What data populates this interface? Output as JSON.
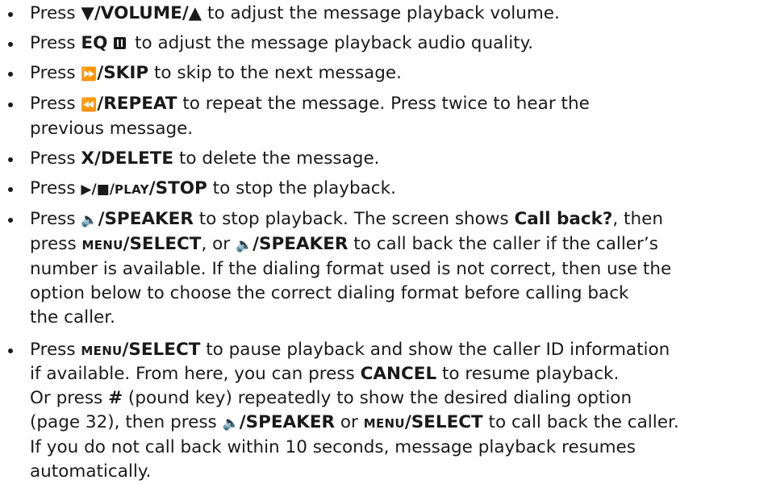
{
  "items": [
    {
      "pre": "Press ",
      "key": "▼/VOLUME/▲",
      "post": " to adjust the message playback volume."
    },
    {
      "pre": "Press ",
      "key": "EQ",
      "icon": "eq-icon",
      "post": " to adjust the message playback audio quality."
    },
    {
      "pre": "Press ",
      "glyph": "⏩",
      "key": "/SKIP",
      "post": " to skip to the next message."
    },
    {
      "pre": "Press ",
      "glyph": "⏪",
      "key": "/REPEAT",
      "post": " to repeat the message. Press twice to hear the",
      "post2": "previous message."
    },
    {
      "pre": "Press ",
      "key": "X/DELETE",
      "post": " to delete the message."
    },
    {
      "pre": "Press ",
      "glyph": "▶/■/",
      "sc": "play",
      "key": "/STOP",
      "post": " to stop the playback."
    },
    {
      "pre": "Press ",
      "glyph": "🔈",
      "key": "/SPEAKER",
      "mid1": " to stop playback. The screen shows ",
      "bold1": "Call back?",
      "mid2": ", then",
      "line2_pre": "press ",
      "sc1": "menu",
      "key2": "/SELECT",
      "mid3": ", or ",
      "glyph2": "🔈",
      "key3": "/SPEAKER",
      "mid4": " to call back the caller if the caller’s",
      "line3": "number is available. If the dialing format used is not correct, then use the",
      "line4": "option below to choose the correct dialing format before calling back",
      "line5": "the caller."
    },
    {
      "pre": "Press ",
      "sc": "menu",
      "key": "/SELECT",
      "mid1": " to pause playback and show the caller ID information",
      "line2_pre": "if available. From here, you can press ",
      "key2": "CANCEL",
      "line2_post": " to resume playback.",
      "line3_pre": "Or press ",
      "key3": "#",
      "line3_post": " (pound key) repeatedly to show the desired dialing option",
      "line4_pre": "(page 32), then press ",
      "glyph": "🔈",
      "key4": "/SPEAKER",
      "line4_mid": " or ",
      "sc2": "menu",
      "key5": "/SELECT",
      "line4_post": " to call back the caller.",
      "line5": "If you do not call back within 10 seconds, message playback resumes",
      "line6": "automatically."
    }
  ]
}
